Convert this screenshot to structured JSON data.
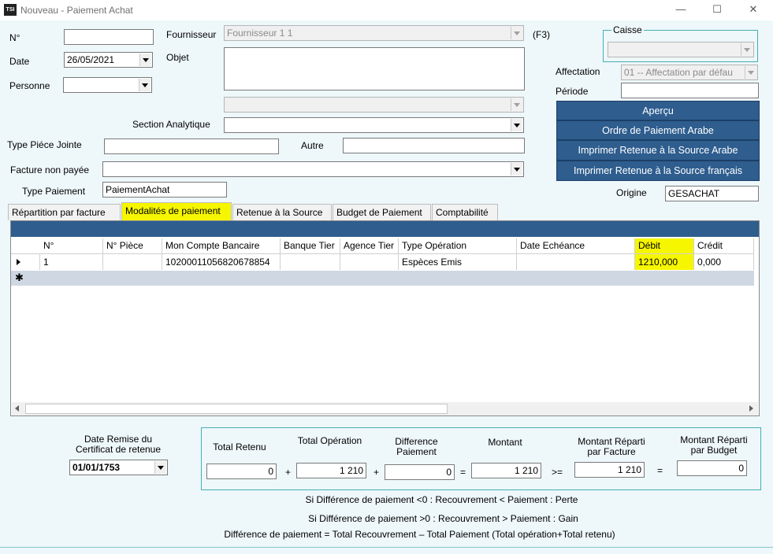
{
  "window": {
    "title": "Nouveau - Paiement Achat",
    "logo": "TSI",
    "minimize": "—",
    "maximize": "☐",
    "close": "✕"
  },
  "form": {
    "num_label": "N°",
    "num_value": "",
    "date_label": "Date",
    "date_value": "26/05/2021",
    "personne_label": "Personne",
    "personne_value": "",
    "fournisseur_label": "Fournisseur",
    "fournisseur_value": "Fournisseur 1 1",
    "f3": "(F3)",
    "objet_label": "Objet",
    "objet_value": "",
    "section_label": "Section Analytique",
    "section_value": "",
    "type_piece_label": "Type Piéce Jointe",
    "type_piece_value": "",
    "autre_label": "Autre",
    "autre_value": "",
    "facture_label": "Facture non payée",
    "facture_value": "",
    "type_paiement_label": "Type Paiement",
    "type_paiement_value": "PaiementAchat",
    "caisse_label": "Caisse",
    "caisse_value": "",
    "affectation_label": "Affectation",
    "affectation_value": "01 -- Affectation par défau",
    "periode_label": "Période",
    "periode_value": "",
    "origine_label": "Origine",
    "origine_value": "GESACHAT"
  },
  "buttons": {
    "apercu": "Aperçu",
    "ordre_arabe": "Ordre de Paiement Arabe",
    "retenue_arabe": "Imprimer Retenue à la Source Arabe",
    "retenue_francais": "Imprimer Retenue à la Source français"
  },
  "tabs": [
    "Répartition par facture",
    "Modalités de paiement",
    "Retenue à la Source",
    "Budget de Paiement",
    "Comptabilité"
  ],
  "grid": {
    "columns": [
      "N°",
      "N° Pièce",
      "Mon Compte Bancaire",
      "Banque Tier",
      "Agence Tier",
      "Type Opération",
      "Date Echéance",
      "Débit",
      "Crédit"
    ],
    "rows": [
      {
        "num": "1",
        "piece": "",
        "compte": "10200011056820678854",
        "banque": "",
        "agence": "",
        "type_op": "Espèces Emis",
        "date_ech": "",
        "debit": "1210,000",
        "credit": "0,000"
      }
    ],
    "new_row_marker": "✱"
  },
  "totals": {
    "date_remise_label": "Date Remise du Certificat de retenue",
    "date_remise_value": "01/01/1753",
    "total_retenu_label": "Total Retenu",
    "total_retenu": "0",
    "total_operation_label": "Total Opération",
    "total_operation": "1 210",
    "difference_label": "Difference Paiement",
    "difference": "0",
    "montant_label": "Montant",
    "montant": "1 210",
    "montant_facture_label": "Montant Réparti par Facture",
    "montant_facture": "1 210",
    "montant_budget_label": "Montant Réparti par Budget",
    "montant_budget": "0",
    "op_plus": "+",
    "op_eq": "=",
    "op_ge": ">="
  },
  "notes": {
    "line1": "Si Différence de paiement <0 : Recouvrement < Paiement : Perte",
    "line2": "Si Différence de paiement >0 : Recouvrement > Paiement : Gain",
    "line3": "Différence de paiement = Total Recouvrement – Total Paiement (Total opération+Total retenu)"
  }
}
